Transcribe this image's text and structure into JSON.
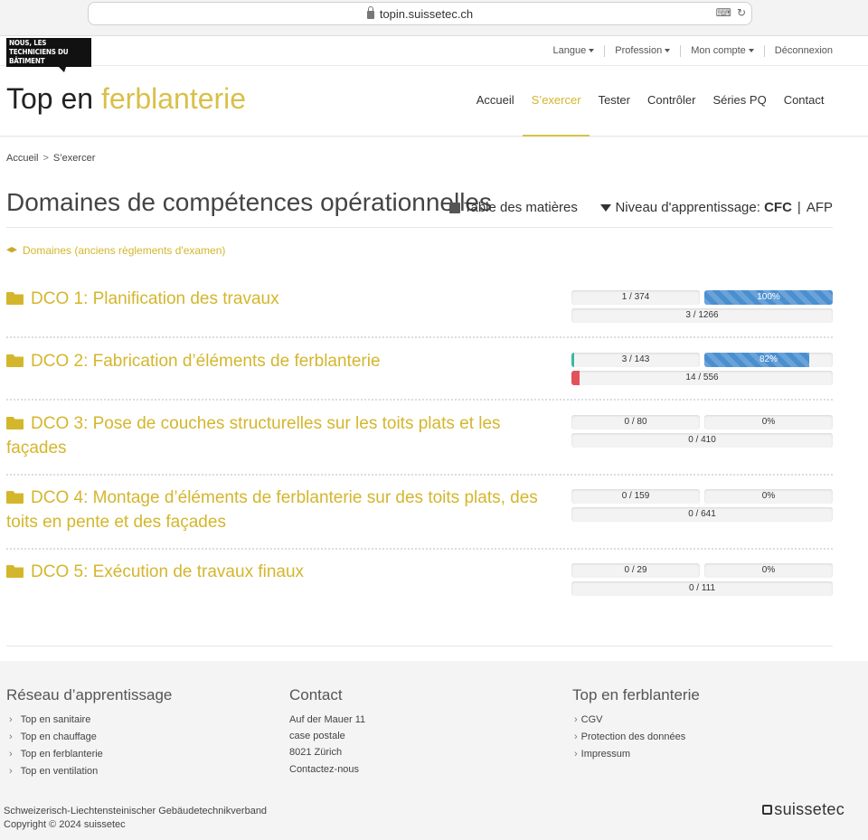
{
  "browser": {
    "url": "topin.suissetec.ch"
  },
  "logo": {
    "line1": "NOUS, LES",
    "line2": "TECHNICIENS DU BÂTIMENT"
  },
  "top_links": [
    {
      "label": "Langue"
    },
    {
      "label": "Profession"
    },
    {
      "label": "Mon compte"
    },
    {
      "label": "Déconnexion"
    }
  ],
  "site": {
    "title_part1": "Top en",
    "title_part2": "ferblanterie"
  },
  "main_nav": [
    "Accueil",
    "S’exercer",
    "Tester",
    "Contrôler",
    "Séries PQ",
    "Contact"
  ],
  "breadcrumb": {
    "home": "Accueil",
    "separator": ">",
    "current": "S’exercer"
  },
  "page": {
    "title": "Domaines de compétences opérationnelles",
    "toc_label": "Table des matières",
    "level_label": "Niveau d'apprentissage:",
    "level_cfc": "CFC",
    "level_sep": "|",
    "level_afp": "AFP",
    "domains_link": "Domaines (anciens règlements d'examen)"
  },
  "dcos": [
    {
      "title": "DCO 1: Planification des travaux",
      "questions": "1 / 374",
      "progress_label": "100%",
      "progress": 1.0,
      "total": "3 / 1266",
      "total_fill": 0,
      "total_color": ""
    },
    {
      "title": "DCO 2: Fabrication d’éléments de ferblanterie",
      "questions": "3 / 143",
      "questions_fill": 0.02,
      "progress_label": "82%",
      "progress": 0.82,
      "total": "14 / 556",
      "total_fill": 0.03,
      "total_color": "#e2525a"
    },
    {
      "title": "DCO 3: Pose de couches structurelles sur les toits plats et les façades",
      "questions": "0 / 80",
      "progress_label": "0%",
      "progress": 0,
      "total": "0 / 410",
      "total_fill": 0
    },
    {
      "title": "DCO 4: Montage d’éléments de ferblanterie sur des toits plats, des toits en pente et des façades",
      "questions": "0 / 159",
      "progress_label": "0%",
      "progress": 0,
      "total": "0 / 641",
      "total_fill": 0
    },
    {
      "title": "DCO 5: Exécution de travaux finaux",
      "questions": "0 / 29",
      "progress_label": "0%",
      "progress": 0,
      "total": "0 / 111",
      "total_fill": 0
    }
  ],
  "footer": {
    "network": {
      "title": "Réseau d’apprentissage",
      "items": [
        "Top en sanitaire",
        "Top en chauffage",
        "Top en ferblanterie",
        "Top en ventilation"
      ]
    },
    "contact": {
      "title": "Contact",
      "address": [
        "Auf der Mauer 11",
        "case postale",
        "8021 Zürich"
      ],
      "link": "Contactez-nous"
    },
    "site": {
      "title": "Top en ferblanterie",
      "items": [
        "CGV",
        "Protection des données",
        "Impressum"
      ]
    },
    "org": "Schweizerisch-Liechtensteinischer Gebäudetechnikverband",
    "copyright": "Copyright © 2024 suissetec",
    "brand": "suissetec"
  },
  "colors": {
    "accent": "#d8c04a",
    "progress_blue": "#4a8fd0",
    "teal": "#3bb8a7",
    "red": "#e2525a"
  }
}
